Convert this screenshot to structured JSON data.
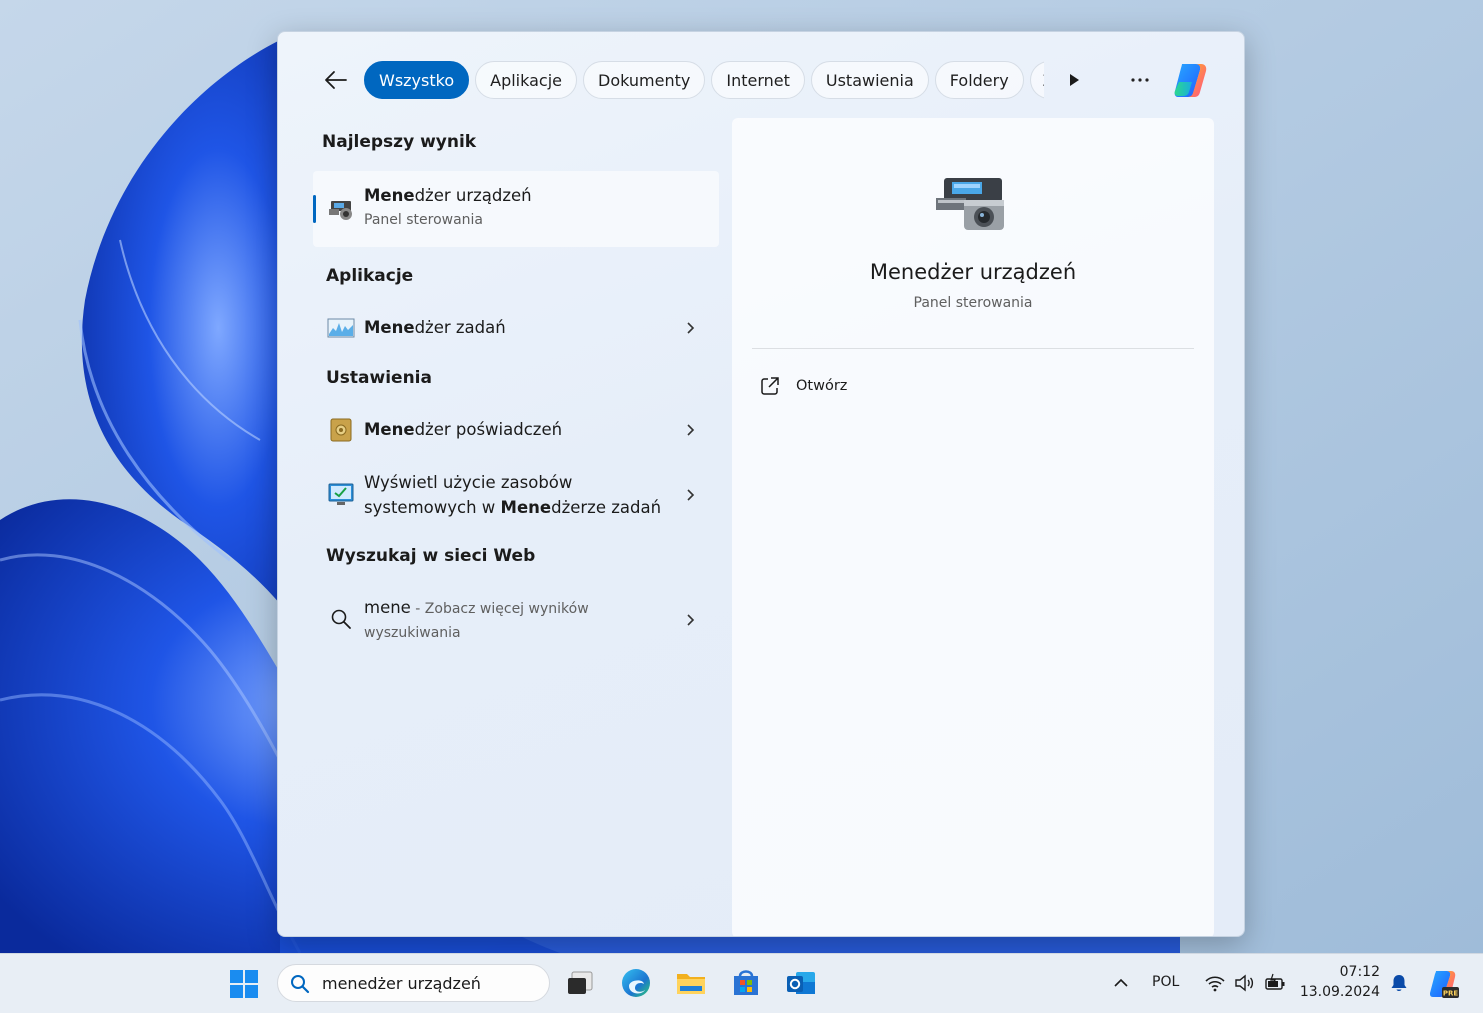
{
  "tabs": [
    {
      "label": "Wszystko",
      "active": true
    },
    {
      "label": "Aplikacje"
    },
    {
      "label": "Dokumenty"
    },
    {
      "label": "Internet"
    },
    {
      "label": "Ustawienia"
    },
    {
      "label": "Foldery"
    },
    {
      "label": "Zd"
    }
  ],
  "sections": {
    "best": "Najlepszy wynik",
    "apps": "Aplikacje",
    "settings": "Ustawienia",
    "web": "Wyszukaj w sieci Web"
  },
  "best_result": {
    "title_bold": "Mene",
    "title_rest": "dżer urządzeń",
    "subtitle": "Panel sterowania"
  },
  "apps": [
    {
      "title_bold": "Mene",
      "title_rest": "dżer zadań"
    }
  ],
  "settings": [
    {
      "title_bold": "Mene",
      "title_rest": "dżer poświadczeń"
    },
    {
      "line1": "Wyświetl użycie zasobów",
      "line2_pre": "systemowych w ",
      "line2_bold": "Mene",
      "line2_rest": "dżerze zadań"
    }
  ],
  "web": {
    "query": "mene",
    "suffix": " - Zobacz więcej wyników",
    "line2": "wyszukiwania"
  },
  "preview": {
    "title": "Menedżer urządzeń",
    "subtitle": "Panel sterowania",
    "action": "Otwórz"
  },
  "taskbar": {
    "search_value": "menedżer urządzeń",
    "language": "POL",
    "time": "07:12",
    "date": "13.09.2024"
  },
  "colors": {
    "accent": "#0067c0",
    "wallpaper": "#1a4fd6"
  },
  "icons": [
    "back-arrow-icon",
    "play-arrow-icon",
    "more-dots-icon",
    "copilot-icon",
    "device-manager-icon",
    "task-manager-icon",
    "credential-manager-icon",
    "resource-monitor-icon",
    "search-icon",
    "external-link-icon",
    "chevron-right-icon",
    "windows-start-icon"
  ]
}
